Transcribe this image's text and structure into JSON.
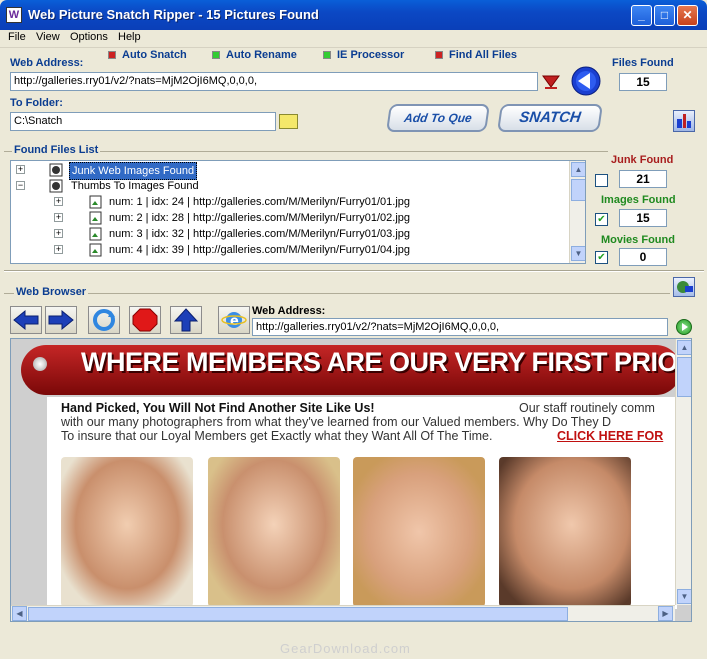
{
  "window": {
    "title": "Web Picture Snatch Ripper - 15 Pictures Found"
  },
  "menu": [
    "File",
    "View",
    "Options",
    "Help"
  ],
  "web_address_label": "Web Address:",
  "web_address_value": "http://galleries.rry01/v2/?nats=MjM2OjI6MQ,0,0,0,",
  "options": {
    "auto_snatch": "Auto Snatch",
    "auto_rename": "Auto Rename",
    "ie_processor": "IE Processor",
    "find_all_files": "Find All Files"
  },
  "files_found": {
    "label": "Files Found",
    "value": "15"
  },
  "to_folder": {
    "label": "To Folder:",
    "value": "C:\\Snatch"
  },
  "buttons": {
    "add_to_que": "Add To Que",
    "snatch": "SNATCH"
  },
  "found_files": {
    "label": "Found Files List",
    "nodes": [
      "Junk Web Images Found",
      "Thumbs To Images Found"
    ],
    "rows": [
      "num: 1  |  idx: 24  |  http://galleries.com/M/Merilyn/Furry01/01.jpg",
      "num: 2  |  idx: 28  |  http://galleries.com/M/Merilyn/Furry01/02.jpg",
      "num: 3  |  idx: 32  |  http://galleries.com/M/Merilyn/Furry01/03.jpg",
      "num: 4  |  idx: 39  |  http://galleries.com/M/Merilyn/Furry01/04.jpg"
    ]
  },
  "counters": {
    "junk": {
      "label": "Junk Found",
      "value": "21",
      "checked": false
    },
    "images": {
      "label": "Images Found",
      "value": "15",
      "checked": true
    },
    "movies": {
      "label": "Movies Found",
      "value": "0",
      "checked": true
    }
  },
  "browser": {
    "label": "Web Browser",
    "address_label": "Web Address:",
    "address_value": "http://galleries.rry01/v2/?nats=MjM2OjI6MQ,0,0,0,"
  },
  "webpage": {
    "banner": "WHERE MEMBERS ARE OUR VERY FIRST PRIORIT",
    "headline": "Hand Picked, You Will Not Find Another Site Like Us!",
    "line1_tail": "Our staff routinely comm",
    "line2": "with our many photographers from what they've learned from our Valued members.  Why Do They D",
    "line3": "To insure that our Loyal Members get Exactly what they Want All Of The Time.",
    "click_here": "CLICK HERE FOR"
  },
  "watermark": "GearDownload.com",
  "colors": {
    "titlebar": "#0a4fd0",
    "banner_red": "#b01a1a",
    "label_blue": "#0b3d91"
  }
}
